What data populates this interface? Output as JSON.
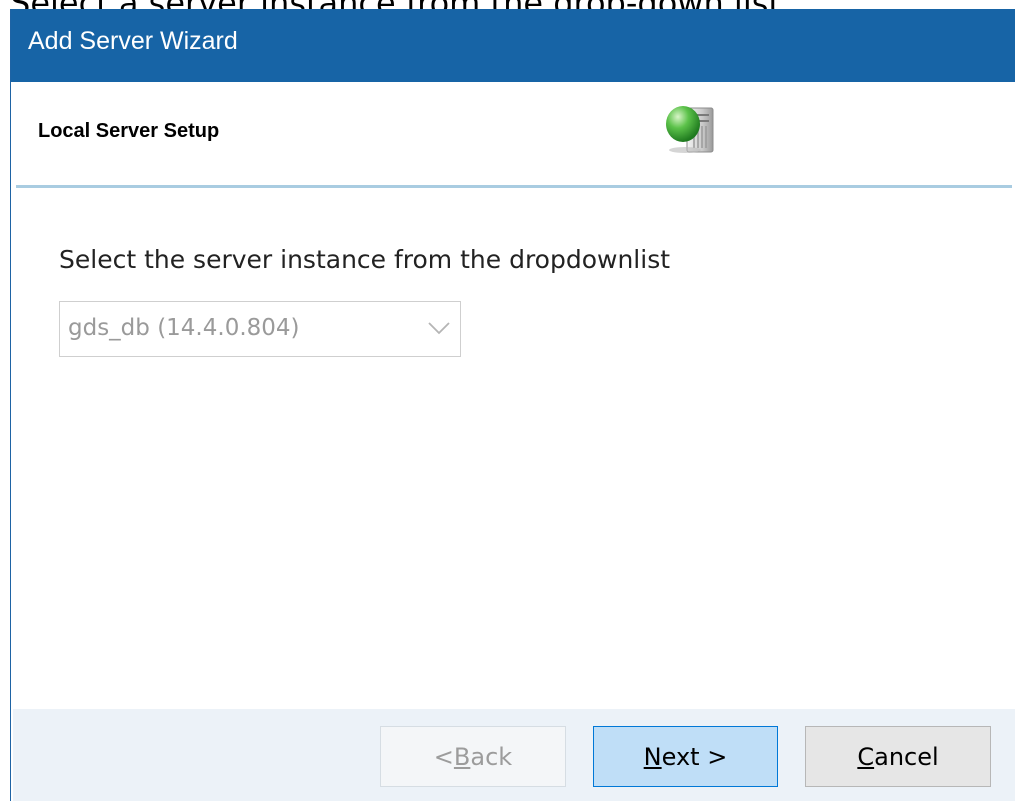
{
  "caption": "Select a server instance from the drop-down list.",
  "window": {
    "title": "Add Server Wizard"
  },
  "header": {
    "title": "Local Server Setup",
    "icon": "server-icon"
  },
  "content": {
    "prompt": "Select the server instance from the dropdownlist",
    "server_select": {
      "selected": "gds_db (14.4.0.804)",
      "enabled": false
    }
  },
  "buttons": {
    "back": {
      "prefix": "< ",
      "mnemonic": "B",
      "rest": "ack",
      "enabled": false
    },
    "next": {
      "prefix": "",
      "mnemonic": "N",
      "rest": "ext >",
      "enabled": true
    },
    "cancel": {
      "prefix": "",
      "mnemonic": "C",
      "rest": "ancel",
      "enabled": true
    }
  },
  "colors": {
    "titlebar": "#1764a6",
    "divider": "#a9cce1",
    "footer": "#ecf2f8",
    "primary_button": "#bfdef7",
    "primary_border": "#0078d7"
  }
}
